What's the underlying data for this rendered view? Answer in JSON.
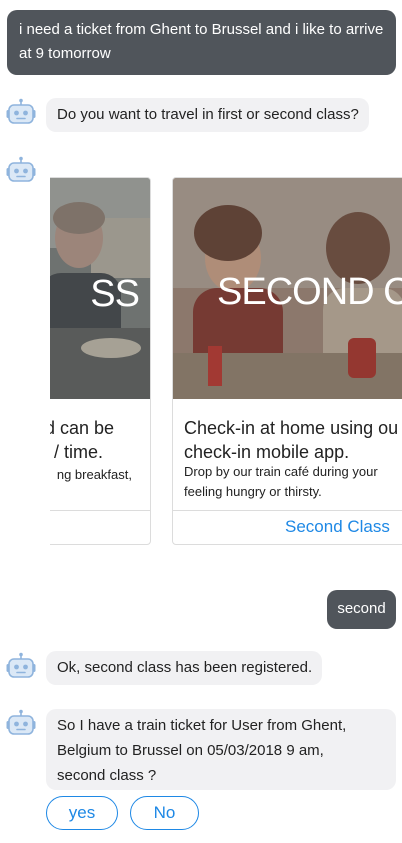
{
  "messages": {
    "user_request": "i need a ticket from Ghent to Brussel and i like to arrive at 9 tomorrow",
    "bot_class_question": "Do you want to travel in first or second class?",
    "user_second": "second",
    "bot_registered": "Ok, second class has been registered.",
    "bot_confirm": "So I have a train ticket for User from Ghent, Belgium to Brussel on 05/03/2018 9 am, second class ?"
  },
  "carousel": {
    "card1": {
      "image_text": "SS",
      "title_line1": "d can be",
      "title_line2": "/ time.",
      "subtitle": "ng breakfast,"
    },
    "card2": {
      "image_text": "SECOND CL",
      "title_line1": "Check-in at home using ou",
      "title_line2": "check-in mobile app.",
      "subtitle_line1": "Drop by our train café during your",
      "subtitle_line2": "feeling hungry or thirsty.",
      "button_label": "Second Class"
    }
  },
  "quick_replies": [
    "yes",
    "No"
  ],
  "colors": {
    "user_bubble": "#50555b",
    "bot_bubble": "#f1f1f3",
    "accent": "#1e88e5",
    "avatar": "#8fb4dd"
  },
  "icons": {
    "bot_avatar": "robot-icon"
  }
}
